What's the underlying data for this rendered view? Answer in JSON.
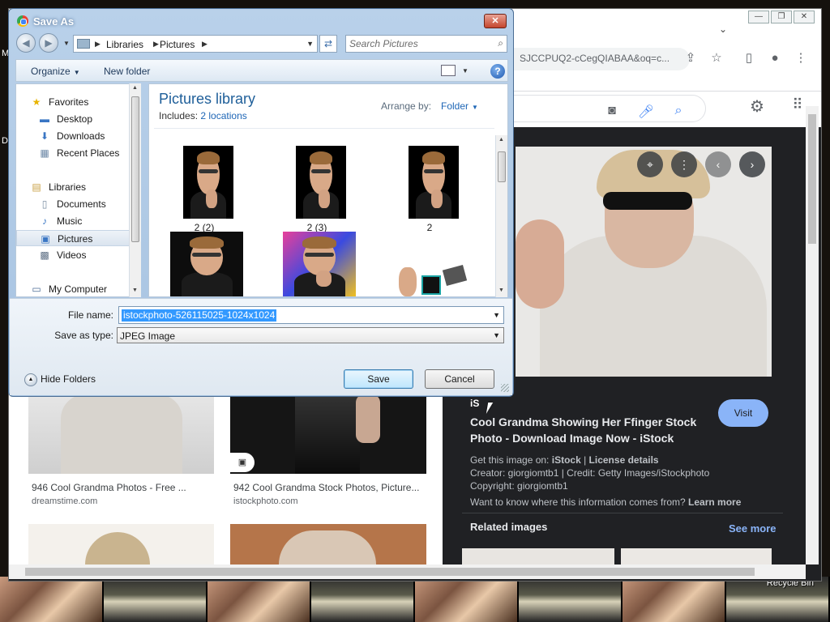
{
  "dialog": {
    "title": "Save As",
    "close_glyph": "✕",
    "address": {
      "crumbs": [
        "Libraries",
        "Pictures"
      ]
    },
    "search_placeholder": "Search Pictures",
    "toolbar": {
      "organize": "Organize",
      "new_folder": "New folder"
    },
    "nav": {
      "items": [
        {
          "label": "Favorites",
          "icon": "star-icon",
          "glyph": "★"
        },
        {
          "label": "Desktop",
          "icon": "desktop-icon",
          "glyph": "▬"
        },
        {
          "label": "Downloads",
          "icon": "downloads-icon",
          "glyph": "⬇"
        },
        {
          "label": "Recent Places",
          "icon": "recent-places-icon",
          "glyph": "▦"
        },
        {
          "label": "Libraries",
          "icon": "libraries-icon",
          "glyph": "▤"
        },
        {
          "label": "Documents",
          "icon": "documents-icon",
          "glyph": "▯"
        },
        {
          "label": "Music",
          "icon": "music-icon",
          "glyph": "♪"
        },
        {
          "label": "Pictures",
          "icon": "pictures-icon",
          "glyph": "▣"
        },
        {
          "label": "Videos",
          "icon": "videos-icon",
          "glyph": "▩"
        },
        {
          "label": "My Computer",
          "icon": "computer-icon",
          "glyph": "▭"
        }
      ]
    },
    "library": {
      "title": "Pictures library",
      "includes_label": "Includes:",
      "includes_link": "2 locations",
      "arrange_label": "Arrange by:",
      "arrange_value": "Folder"
    },
    "files": [
      {
        "label": "2 (2)"
      },
      {
        "label": "2 (3)"
      },
      {
        "label": "2"
      },
      {
        "label": ""
      },
      {
        "label": ""
      },
      {
        "label": ""
      }
    ],
    "file_name_label": "File name:",
    "file_name_value": "istockphoto-526115025-1024x1024",
    "save_type_label": "Save as type:",
    "save_type_value": "JPEG Image",
    "hide_folders": "Hide Folders",
    "save_button": "Save",
    "cancel_button": "Cancel"
  },
  "browser": {
    "url_fragment": "SJCCPUQ2-cCegQIABAA&oq=c...",
    "results": [
      {
        "title": "946 Cool Grandma Photos - Free ...",
        "source": "dreamstime.com"
      },
      {
        "title": "942 Cool Grandma Stock Photos, Picture...",
        "source": "istockphoto.com"
      }
    ],
    "preview": {
      "site_logo": "iS",
      "title": "Cool Grandma Showing Her Ffinger Stock Photo - Download Image Now - iStock",
      "visit": "Visit",
      "get_on_label": "Get this image on:",
      "get_on_site": "iStock",
      "license": "License details",
      "creator": "Creator: giorgiomtb1 | Credit: Getty Images/iStockphoto",
      "copyright": "Copyright: giorgiomtb1",
      "where_from": "Want to know where this information comes from?",
      "learn_more": "Learn more",
      "related": "Related images",
      "see_more": "See more"
    }
  },
  "desktop": {
    "recycle_bin": "Recycle Bin",
    "edge_letter_1": "M",
    "edge_letter_2": "D"
  }
}
